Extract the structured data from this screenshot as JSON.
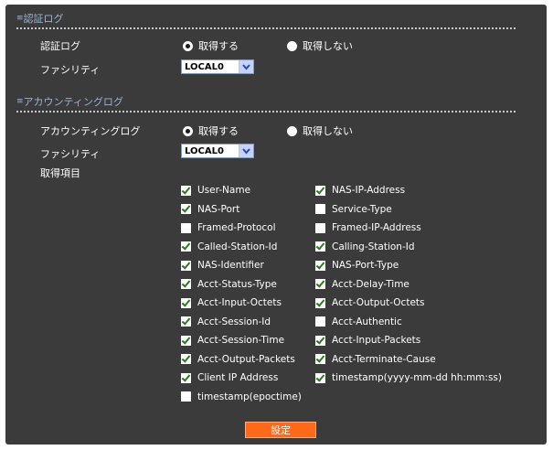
{
  "auth_log": {
    "title": "認証ログ",
    "log_label": "認証ログ",
    "radio_on": "取得する",
    "radio_off": "取得しない",
    "facility_label": "ファシリティ",
    "facility_value": "LOCAL0"
  },
  "accounting_log": {
    "title": "アカウンティングログ",
    "log_label": "アカウンティングログ",
    "radio_on": "取得する",
    "radio_off": "取得しない",
    "facility_label": "ファシリティ",
    "facility_value": "LOCAL0",
    "items_label": "取得項目"
  },
  "items": [
    {
      "label": "User-Name",
      "checked": true
    },
    {
      "label": "NAS-IP-Address",
      "checked": true
    },
    {
      "label": "NAS-Port",
      "checked": true
    },
    {
      "label": "Service-Type",
      "checked": false
    },
    {
      "label": "Framed-Protocol",
      "checked": false
    },
    {
      "label": "Framed-IP-Address",
      "checked": false
    },
    {
      "label": "Called-Station-Id",
      "checked": true
    },
    {
      "label": "Calling-Station-Id",
      "checked": true
    },
    {
      "label": "NAS-Identifier",
      "checked": true
    },
    {
      "label": "NAS-Port-Type",
      "checked": true
    },
    {
      "label": "Acct-Status-Type",
      "checked": true
    },
    {
      "label": "Acct-Delay-Time",
      "checked": true
    },
    {
      "label": "Acct-Input-Octets",
      "checked": true
    },
    {
      "label": "Acct-Output-Octets",
      "checked": true
    },
    {
      "label": "Acct-Session-Id",
      "checked": true
    },
    {
      "label": "Acct-Authentic",
      "checked": false
    },
    {
      "label": "Acct-Session-Time",
      "checked": true
    },
    {
      "label": "Acct-Input-Packets",
      "checked": true
    },
    {
      "label": "Acct-Output-Packets",
      "checked": true
    },
    {
      "label": "Acct-Terminate-Cause",
      "checked": true
    },
    {
      "label": "Client IP Address",
      "checked": true
    },
    {
      "label": "timestamp(yyyy-mm-dd hh:mm:ss)",
      "checked": true
    },
    {
      "label": "timestamp(epoctime)",
      "checked": false
    }
  ],
  "submit_label": "設定",
  "colors": {
    "panel_bg": "#3b3b3b",
    "section_title": "#9ab4d6",
    "button_bg": "#ff6a1a",
    "check_mark": "#2a7a1e"
  }
}
